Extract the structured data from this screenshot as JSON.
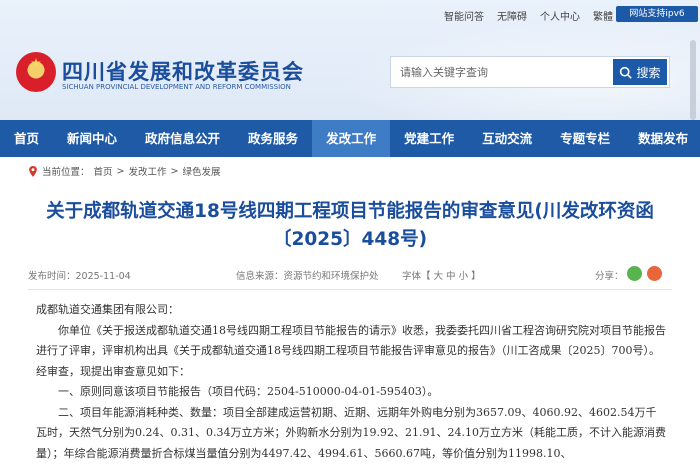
{
  "toplinks": [
    "智能问答",
    "无障碍",
    "个人中心",
    "繁體"
  ],
  "ipv6": "网站支持ipv6",
  "site": {
    "name": "四川省发展和改革委员会",
    "name_en": "SICHUAN PROVINCIAL DEVELOPMENT AND REFORM COMMISSION"
  },
  "search": {
    "placeholder": "请输入关键字查询",
    "button": "搜索"
  },
  "nav": [
    "首页",
    "新闻中心",
    "政府信息公开",
    "政务服务",
    "发改工作",
    "党建工作",
    "互动交流",
    "专题专栏",
    "数据发布"
  ],
  "nav_active_index": 4,
  "breadcrumb": {
    "prefix": "当前位置：",
    "items": [
      "首页",
      "发改工作",
      "绿色发展"
    ],
    "sep": ">"
  },
  "article": {
    "title": "关于成都轨道交通18号线四期工程项目节能报告的审查意见(川发改环资函〔2025〕448号)",
    "date": "发布时间：2025-11-04",
    "source": "信息来源：资源节约和环境保护处",
    "fontsize": "字体【 大 中 小 】",
    "share": "分享：",
    "paragraphs": [
      "成都轨道交通集团有限公司：",
      "你单位《关于报送成都轨道交通18号线四期工程项目节能报告的请示》收悉，我委委托四川省工程咨询研究院对项目节能报告进行了评审，评审机构出具《关于成都轨道交通18号线四期工程项目节能报告评审意见的报告》（川工咨成果〔2025〕700号）。经审查，现提出审查意见如下：",
      "一、原则同意该项目节能报告（项目代码：2504-510000-04-01-595403）。",
      "二、项目年能源消耗种类、数量：项目全部建成运营初期、近期、远期年外购电分别为3657.09、4060.92、4602.54万千瓦时，天然气分别为0.24、0.31、0.34万立方米；外购新水分别为19.92、21.91、24.10万立方米（耗能工质，不计入能源消费量）；年综合能源消费量折合标煤当量值分别为4497.42、4994.61、5660.67吨，等价值分别为11998.10、"
    ]
  },
  "colors": {
    "nav_bg": "#1f5aa6",
    "nav_active": "#3f7cc6",
    "title": "#1a4d9c"
  }
}
